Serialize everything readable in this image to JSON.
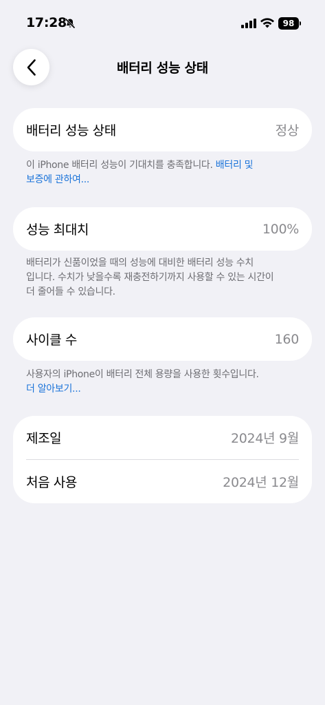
{
  "status_bar": {
    "time": "17:28",
    "battery_level": "98"
  },
  "nav": {
    "title": "배터리 성능 상태"
  },
  "battery_health": {
    "label": "배터리 성능 상태",
    "value": "정상",
    "note": "이 iPhone 배터리 성능이 기대치를 충족합니다. ",
    "link_line1": "배터리 및",
    "link_line2": "보증에 관하여..."
  },
  "max_capacity": {
    "label": "성능 최대치",
    "value": "100%",
    "note_line1": "배터리가 신품이었을 때의 성능에 대비한 배터리 성능 수치",
    "note_line2": "입니다. 수치가 낮을수록 재충전하기까지 사용할 수 있는 시간이",
    "note_line3": "더 줄어들 수 있습니다."
  },
  "cycle_count": {
    "label": "사이클 수",
    "value": "160",
    "note": "사용자의 iPhone이 배터리 전체 용량을 사용한 횟수입니다.",
    "link": "더 알아보기..."
  },
  "dates": {
    "manufacture_label": "제조일",
    "manufacture_value": "2024년 9월",
    "first_use_label": "처음 사용",
    "first_use_value": "2024년 12월"
  }
}
